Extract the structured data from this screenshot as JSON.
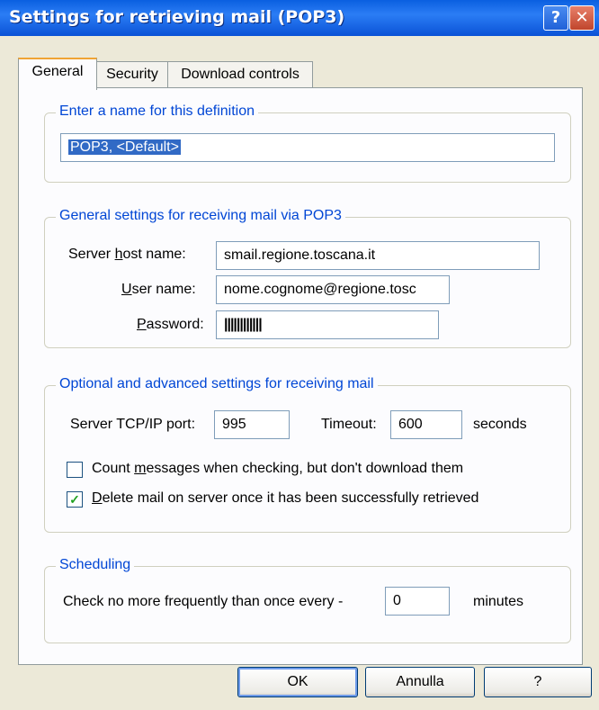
{
  "window": {
    "title": "Settings for retrieving mail (POP3)",
    "help_glyph": "?",
    "close_glyph": "✕"
  },
  "tabs": [
    {
      "label": "General",
      "active": true
    },
    {
      "label": "Security",
      "active": false
    },
    {
      "label": "Download controls",
      "active": false
    }
  ],
  "definition": {
    "group_title": "Enter a name for this definition",
    "name_value": "POP3, <Default>"
  },
  "general": {
    "group_title": "General settings for receiving mail via POP3",
    "server_host_label_pre": "Server ",
    "server_host_label_u": "h",
    "server_host_label_post": "ost name:",
    "server_host_value": "smail.regione.toscana.it",
    "user_label_u": "U",
    "user_label_post": "ser name:",
    "user_value": "nome.cognome@regione.tosc",
    "password_label_u": "P",
    "password_label_post": "assword:",
    "password_value": "||||||||||||"
  },
  "advanced": {
    "group_title": "Optional and advanced settings for receiving mail",
    "port_label": "Server TCP/IP port:",
    "port_value": "995",
    "timeout_label": "Timeout:",
    "timeout_value": "600",
    "timeout_unit": "seconds",
    "count_label_pre": "Count ",
    "count_label_u": "m",
    "count_label_post": "essages when checking, but don't download them",
    "count_checked": false,
    "delete_label_u": "D",
    "delete_label_post": "elete mail on server once it has been successfully retrieved",
    "delete_checked": true,
    "check_mark": "✓"
  },
  "scheduling": {
    "group_title": "Scheduling",
    "label": "Check no more frequently than once every -",
    "value": "0",
    "unit": "minutes"
  },
  "buttons": {
    "ok": "OK",
    "cancel": "Annulla",
    "help": "?"
  }
}
